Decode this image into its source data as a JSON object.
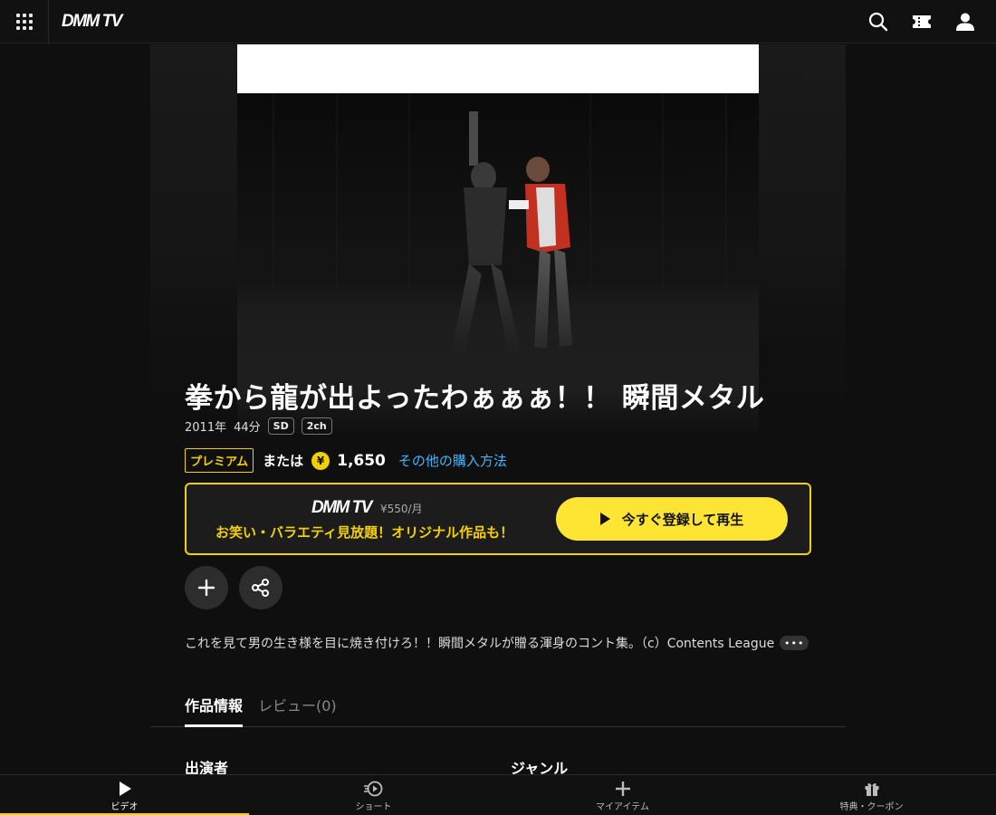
{
  "header": {
    "logo": "DMM TV"
  },
  "video": {
    "title": "拳から龍が出よったわぁぁぁ！！ 瞬間メタル",
    "year": "2011年",
    "duration": "44分",
    "badges": [
      "SD",
      "2ch"
    ]
  },
  "purchase": {
    "premium_label": "プレミアム",
    "or_label": "または",
    "yen_symbol": "¥",
    "price": "1,650",
    "other_methods": "その他の購入方法"
  },
  "promo": {
    "logo": "DMM TV",
    "monthly_price": "¥550/月",
    "tagline": "お笑い・バラエティ見放題！オリジナル作品も！",
    "cta_label": "今すぐ登録して再生"
  },
  "description": {
    "text": "これを見て男の生き様を目に焼き付けろ！！瞬間メタルが贈る渾身のコント集。（c）Contents League",
    "more": "•••"
  },
  "tabs": [
    {
      "label": "作品情報"
    },
    {
      "label": "レビュー(0)"
    }
  ],
  "sections": {
    "cast": "出演者",
    "genre": "ジャンル"
  },
  "bottom_nav": [
    {
      "label": "ビデオ",
      "icon": "play-icon"
    },
    {
      "label": "ショート",
      "icon": "short-icon"
    },
    {
      "label": "マイアイテム",
      "icon": "plus-icon"
    },
    {
      "label": "特典・クーポン",
      "icon": "gift-icon"
    }
  ],
  "colors": {
    "accent": "#f5d000",
    "cta": "#ffe533",
    "link": "#3fb7ff",
    "background": "#0f0f0f"
  }
}
